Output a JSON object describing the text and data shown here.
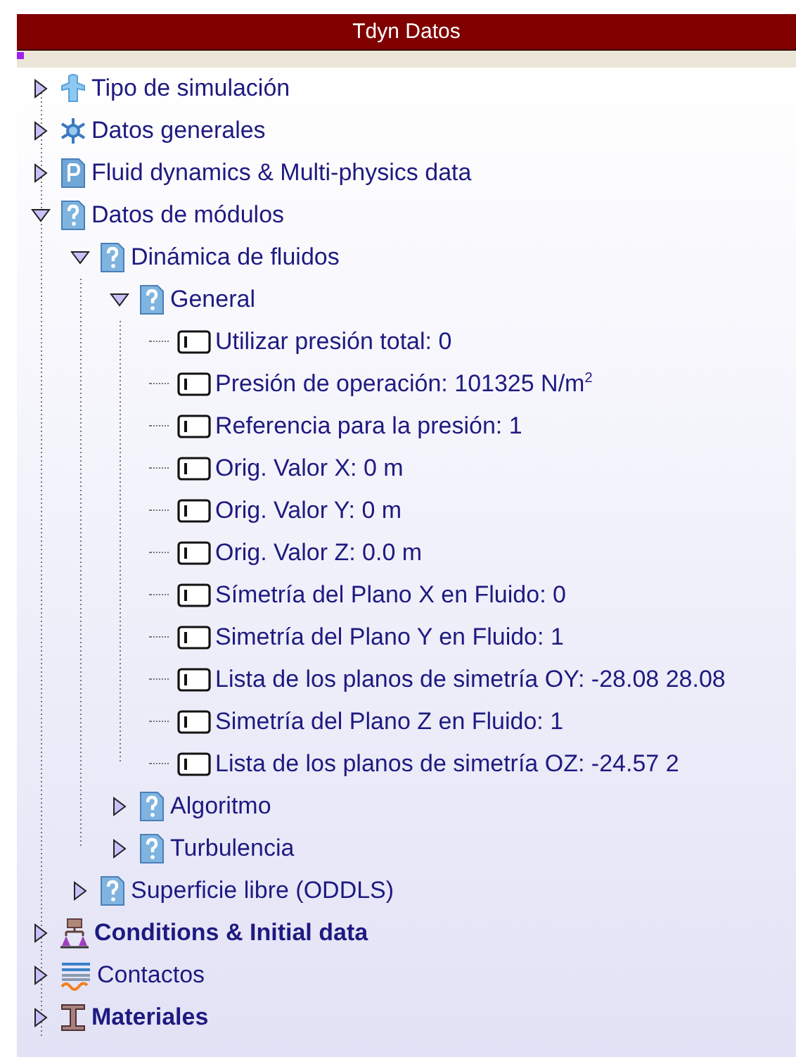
{
  "window": {
    "title": "Tdyn Datos"
  },
  "tree": [
    {
      "label": "Tipo de simulación",
      "kind": "figure",
      "expanded": false
    },
    {
      "label": "Datos generales",
      "kind": "snowflake",
      "expanded": false
    },
    {
      "label": "Fluid dynamics & Multi-physics data",
      "kind": "pdoc",
      "expanded": false
    },
    {
      "label": "Datos de módulos",
      "kind": "help",
      "expanded": true,
      "children": [
        {
          "label": "Dinámica de fluidos",
          "kind": "help",
          "expanded": true,
          "children": [
            {
              "label": "General",
              "kind": "help",
              "expanded": true,
              "children": [
                {
                  "label": "Utilizar presión total: 0",
                  "kind": "field"
                },
                {
                  "label": "Presión de operación: 101325 N/m$^{2}$",
                  "kind": "field"
                },
                {
                  "label": "Referencia para la presión: 1",
                  "kind": "field"
                },
                {
                  "label": "Orig. Valor X: 0 m",
                  "kind": "field"
                },
                {
                  "label": "Orig. Valor Y: 0 m",
                  "kind": "field"
                },
                {
                  "label": "Orig. Valor Z: 0.0 m",
                  "kind": "field"
                },
                {
                  "label": "Símetría del Plano X en Fluido: 0",
                  "kind": "field"
                },
                {
                  "label": "Simetría del Plano Y en Fluido: 1",
                  "kind": "field"
                },
                {
                  "label": "Lista de los planos de simetría OY: -28.08 28.08",
                  "kind": "field"
                },
                {
                  "label": "Simetría del Plano Z en Fluido: 1",
                  "kind": "field"
                },
                {
                  "label": "Lista de los planos de simetría OZ: -24.57 2",
                  "kind": "field"
                }
              ]
            },
            {
              "label": "Algoritmo",
              "kind": "help",
              "expanded": false
            },
            {
              "label": "Turbulencia",
              "kind": "help",
              "expanded": false
            }
          ]
        },
        {
          "label": "Superficie libre (ODDLS)",
          "kind": "help",
          "expanded": false
        }
      ]
    },
    {
      "label": "Conditions & Initial data",
      "kind": "hierarchy",
      "expanded": false,
      "bold": true
    },
    {
      "label": "Contactos",
      "kind": "lines",
      "expanded": false
    },
    {
      "label": "Materiales",
      "kind": "beam",
      "expanded": false,
      "bold": true
    }
  ]
}
